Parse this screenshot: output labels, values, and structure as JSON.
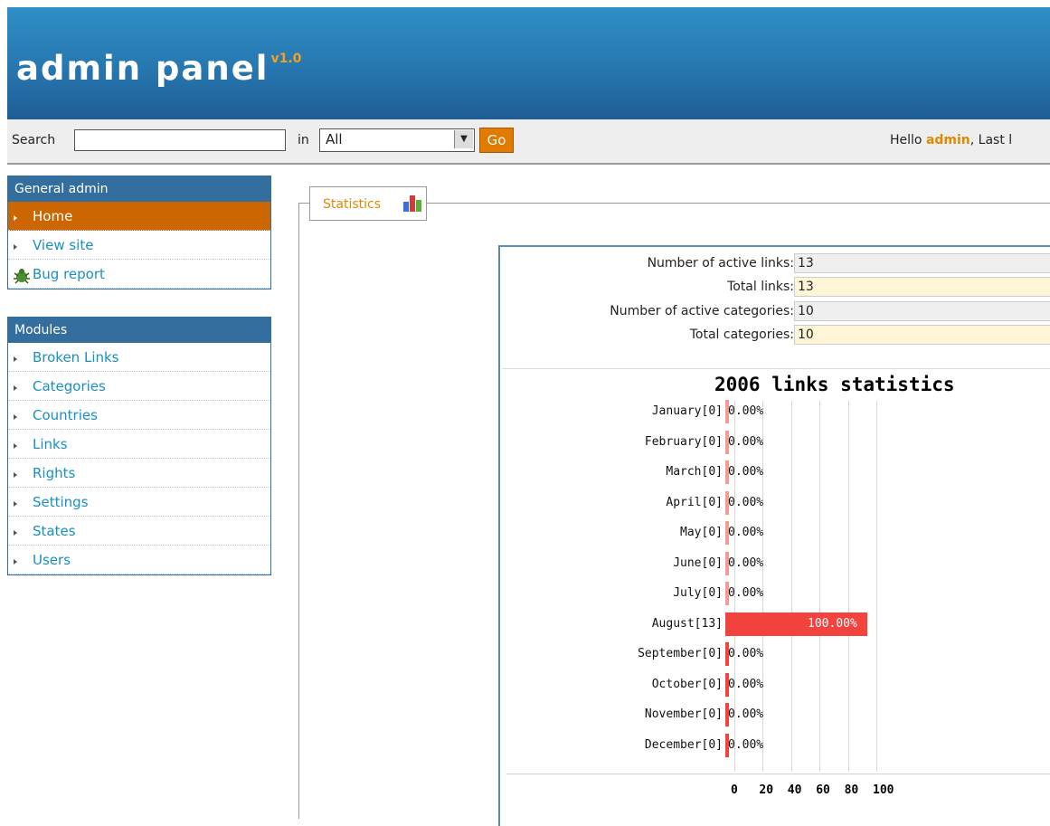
{
  "header": {
    "logo": "admin panel",
    "version": "v1.0"
  },
  "searchbar": {
    "search_label": "Search",
    "search_value": "",
    "in_label": "in",
    "scope_selected": "All",
    "go_label": "Go",
    "hello_prefix": "Hello ",
    "user": "admin",
    "hello_suffix": ", Last l"
  },
  "sidebar": {
    "general": {
      "title": "General admin",
      "items": [
        {
          "label": "Home"
        },
        {
          "label": "View site"
        },
        {
          "label": "Bug report"
        }
      ]
    },
    "modules": {
      "title": "Modules",
      "items": [
        {
          "label": "Broken Links"
        },
        {
          "label": "Categories"
        },
        {
          "label": "Countries"
        },
        {
          "label": "Links"
        },
        {
          "label": "Rights"
        },
        {
          "label": "Settings"
        },
        {
          "label": "States"
        },
        {
          "label": "Users"
        }
      ]
    }
  },
  "main": {
    "tab": "Statistics",
    "stats": [
      {
        "label": "Number of active links:",
        "value": "13"
      },
      {
        "label": "Total links:",
        "value": "13"
      },
      {
        "label": "Number of active categories:",
        "value": "10"
      },
      {
        "label": "Total categories:",
        "value": "10"
      }
    ]
  },
  "colors": {
    "accent": "#cc6600",
    "header": "#2776af",
    "bar": "#f2433f"
  },
  "chart_data": {
    "type": "bar",
    "orientation": "horizontal",
    "title": "2006 links statistics",
    "categories": [
      "January[0]",
      "February[0]",
      "March[0]",
      "April[0]",
      "May[0]",
      "June[0]",
      "July[0]",
      "August[13]",
      "September[0]",
      "October[0]",
      "November[0]",
      "December[0]"
    ],
    "values": [
      0,
      0,
      0,
      0,
      0,
      0,
      0,
      100,
      0,
      0,
      0,
      0
    ],
    "value_labels": [
      "0.00%",
      "0.00%",
      "0.00%",
      "0.00%",
      "0.00%",
      "0.00%",
      "0.00%",
      "100.00%",
      "0.00%",
      "0.00%",
      "0.00%",
      "0.00%"
    ],
    "xticks": [
      "0",
      "20",
      "40",
      "60",
      "80",
      "100"
    ],
    "xlim": [
      0,
      100
    ]
  }
}
